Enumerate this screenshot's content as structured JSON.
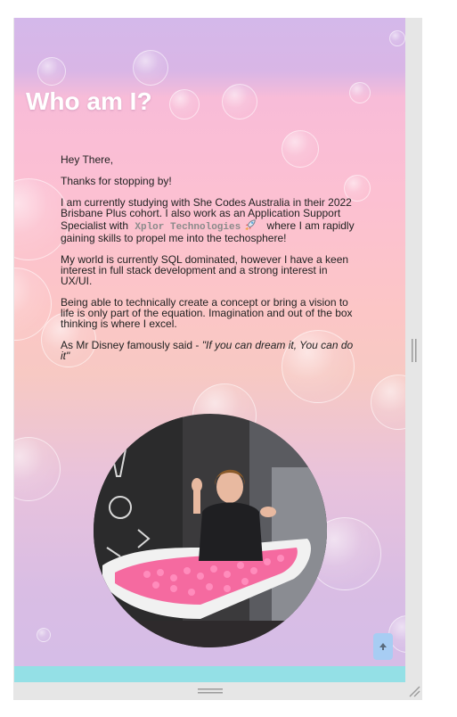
{
  "page": {
    "title": "Who am I?",
    "greeting": "Hey There,",
    "thanks": "Thanks for stopping by!",
    "intro_before": "I am currently studying with She Codes Australia in their 2022 Brisbane Plus cohort. I also work as an Application Support Specialist with",
    "company": "Xplor Technologies",
    "intro_after": "where I am rapidly gaining skills to propel me into the techosphere!",
    "sql": "My world is currently SQL dominated, however I have a keen interest in full stack development and a strong interest in UX/UI.",
    "vision": "Being able to technically create a concept or bring a vision to life is only part of the equation. Imagination and out of the box thinking is where I excel.",
    "disney_prefix": "As Mr Disney famously said - ",
    "disney_quote": "\"If you can dream it, You can do it\""
  },
  "icons": {
    "rocket": "rocket-icon",
    "back_to_top": "arrow-up-icon"
  },
  "colors": {
    "title_text": "#ffffff",
    "body_text": "#222222",
    "company_text": "#8a8a8a",
    "back_to_top_button": "#a7cdf3",
    "footer_strip": "#94e0e6",
    "frame": "#e6e6e6"
  }
}
